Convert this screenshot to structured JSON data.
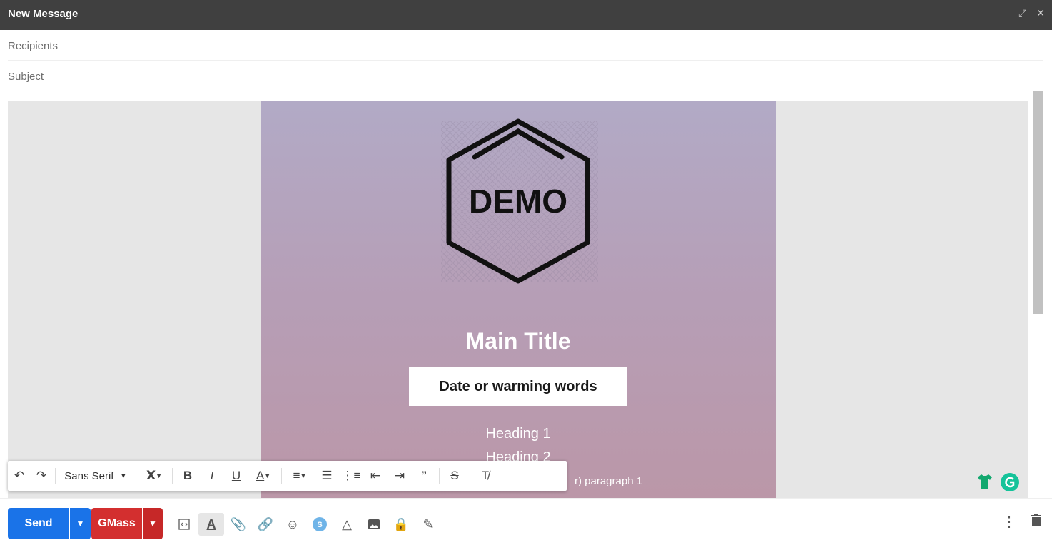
{
  "window": {
    "title": "New Message"
  },
  "fields": {
    "recipients": "Recipients",
    "subject": "Subject"
  },
  "email": {
    "logo_text": "DEMO",
    "main_title": "Main Title",
    "date_box": "Date or warming words",
    "heading1": "Heading 1",
    "heading2": "Heading 2",
    "paragraph_partial": "r) paragraph 1"
  },
  "format_toolbar": {
    "font_family": "Sans Serif",
    "icons": [
      "undo-icon",
      "redo-icon",
      "font-size-icon",
      "bold-icon",
      "italic-icon",
      "underline-icon",
      "text-color-icon",
      "align-icon",
      "numbered-list-icon",
      "bulleted-list-icon",
      "indent-less-icon",
      "indent-more-icon",
      "quote-icon",
      "strikethrough-icon",
      "remove-formatting-icon"
    ]
  },
  "bottom_bar": {
    "send_label": "Send",
    "gmass_label": "GMass"
  },
  "colors": {
    "send_blue": "#1a73e8",
    "gmass_red": "#d32f2f",
    "titlebar": "#404040"
  }
}
